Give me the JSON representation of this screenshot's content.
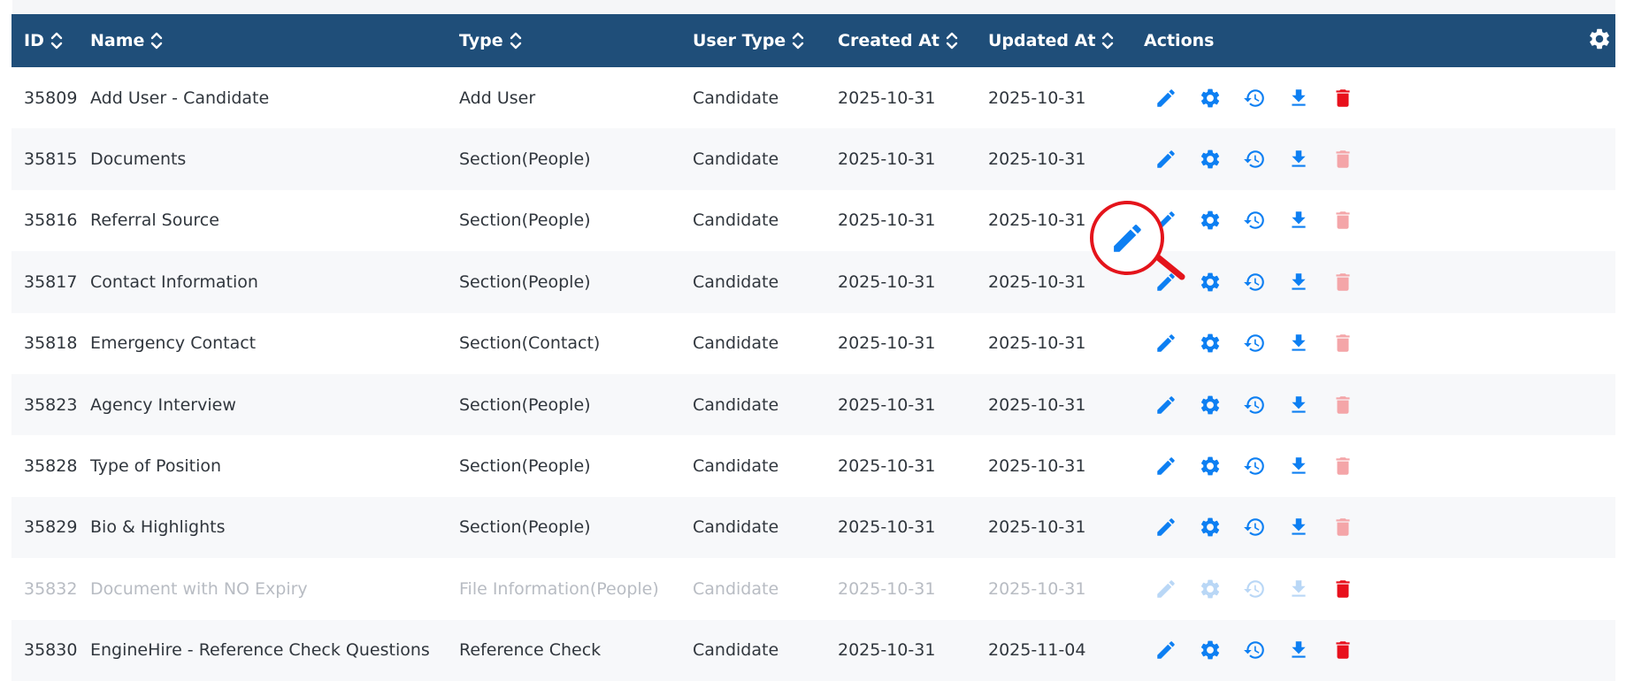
{
  "colors": {
    "header_bg": "#1f4e79",
    "icon_blue": "#0d7ff2",
    "icon_red": "#e8101c",
    "icon_red_disabled": "#f4a5a8",
    "icon_blue_disabled": "#b9d7f6"
  },
  "table": {
    "headers": [
      {
        "label": "ID",
        "sortable": true
      },
      {
        "label": "Name",
        "sortable": true
      },
      {
        "label": "Type",
        "sortable": true
      },
      {
        "label": "User Type",
        "sortable": true
      },
      {
        "label": "Created At",
        "sortable": true
      },
      {
        "label": "Updated At",
        "sortable": true
      },
      {
        "label": "Actions",
        "sortable": false
      }
    ],
    "rows": [
      {
        "id": "35809",
        "name": "Add User - Candidate",
        "type": "Add User",
        "user_type": "Candidate",
        "created": "2025-10-31",
        "updated": "2025-10-31",
        "disabled": false,
        "delete_enabled": true
      },
      {
        "id": "35815",
        "name": "Documents",
        "type": "Section(People)",
        "user_type": "Candidate",
        "created": "2025-10-31",
        "updated": "2025-10-31",
        "disabled": false,
        "delete_enabled": false
      },
      {
        "id": "35816",
        "name": "Referral Source",
        "type": "Section(People)",
        "user_type": "Candidate",
        "created": "2025-10-31",
        "updated": "2025-10-31",
        "disabled": false,
        "delete_enabled": false
      },
      {
        "id": "35817",
        "name": "Contact Information",
        "type": "Section(People)",
        "user_type": "Candidate",
        "created": "2025-10-31",
        "updated": "2025-10-31",
        "disabled": false,
        "delete_enabled": false
      },
      {
        "id": "35818",
        "name": "Emergency Contact",
        "type": "Section(Contact)",
        "user_type": "Candidate",
        "created": "2025-10-31",
        "updated": "2025-10-31",
        "disabled": false,
        "delete_enabled": false
      },
      {
        "id": "35823",
        "name": "Agency Interview",
        "type": "Section(People)",
        "user_type": "Candidate",
        "created": "2025-10-31",
        "updated": "2025-10-31",
        "disabled": false,
        "delete_enabled": false
      },
      {
        "id": "35828",
        "name": "Type of Position",
        "type": "Section(People)",
        "user_type": "Candidate",
        "created": "2025-10-31",
        "updated": "2025-10-31",
        "disabled": false,
        "delete_enabled": false
      },
      {
        "id": "35829",
        "name": "Bio & Highlights",
        "type": "Section(People)",
        "user_type": "Candidate",
        "created": "2025-10-31",
        "updated": "2025-10-31",
        "disabled": false,
        "delete_enabled": false
      },
      {
        "id": "35832",
        "name": "Document with NO Expiry",
        "type": "File Information(People)",
        "user_type": "Candidate",
        "created": "2025-10-31",
        "updated": "2025-10-31",
        "disabled": true,
        "delete_enabled": true
      },
      {
        "id": "35830",
        "name": "EngineHire - Reference Check Questions",
        "type": "Reference Check",
        "user_type": "Candidate",
        "created": "2025-10-31",
        "updated": "2025-11-04",
        "disabled": false,
        "delete_enabled": true
      }
    ],
    "row_actions": [
      "edit-icon",
      "settings-gear-icon",
      "history-icon",
      "download-icon",
      "trash-icon"
    ]
  }
}
